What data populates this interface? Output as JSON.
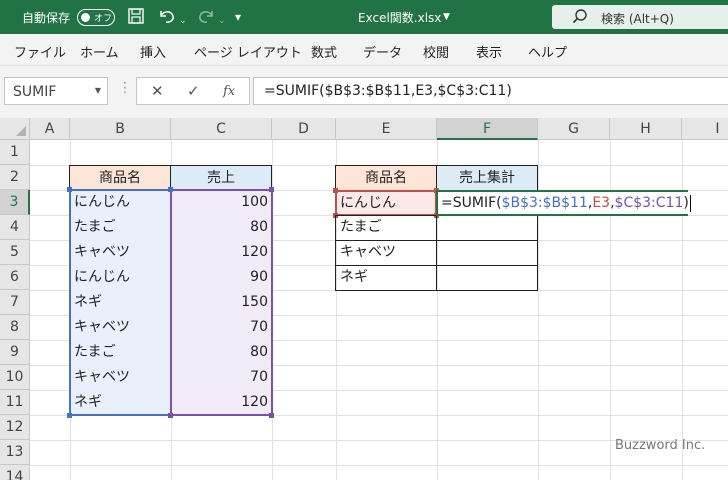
{
  "titlebar": {
    "autosave_label": "自動保存",
    "autosave_state": "オフ",
    "filename": "Excel関数.xlsx",
    "search_label": "検索 (Alt+Q)"
  },
  "menu": [
    "ファイル",
    "ホーム",
    "挿入",
    "ページ レイアウト",
    "数式",
    "データ",
    "校閲",
    "表示",
    "ヘルプ"
  ],
  "formula_bar": {
    "name_box": "SUMIF",
    "cancel_symbol": "✕",
    "enter_symbol": "✓",
    "fx_symbol": "fx",
    "formula": "=SUMIF($B$3:$B$11,E3,$C$3:C11)"
  },
  "columns": [
    "A",
    "B",
    "C",
    "D",
    "E",
    "F",
    "G",
    "H",
    "I"
  ],
  "rows": [
    "1",
    "2",
    "3",
    "4",
    "5",
    "6",
    "7",
    "8",
    "9",
    "10",
    "11",
    "12",
    "13",
    "14"
  ],
  "table1": {
    "headers": [
      "商品名",
      "売上"
    ],
    "rows": [
      [
        "にんじん",
        "100"
      ],
      [
        "たまご",
        "80"
      ],
      [
        "キャベツ",
        "120"
      ],
      [
        "にんじん",
        "90"
      ],
      [
        "ネギ",
        "150"
      ],
      [
        "キャベツ",
        "70"
      ],
      [
        "たまご",
        "80"
      ],
      [
        "キャベツ",
        "70"
      ],
      [
        "ネギ",
        "120"
      ]
    ]
  },
  "table2": {
    "headers": [
      "商品名",
      "売上集計"
    ],
    "items": [
      "にんじん",
      "たまご",
      "キャベツ",
      "ネギ"
    ]
  },
  "edit_cell": {
    "tokens": [
      {
        "text": "=SUMIF(",
        "color": "black"
      },
      {
        "text": "$B$3:$B$11",
        "color": "blue"
      },
      {
        "text": ",",
        "color": "black"
      },
      {
        "text": "E3",
        "color": "red"
      },
      {
        "text": ",",
        "color": "black"
      },
      {
        "text": "$C$3:C11",
        "color": "purple"
      },
      {
        "text": ")",
        "color": "black"
      }
    ]
  },
  "selection": {
    "column": "F",
    "row": "3"
  },
  "watermark": "Buzzword Inc.",
  "colors": {
    "excel_green": "#217346",
    "range_blue": "#4472c4",
    "range_red": "#c0504d",
    "range_purple": "#7b51a8",
    "header_orange": "#fce4d6",
    "header_blue": "#ddebf7"
  }
}
